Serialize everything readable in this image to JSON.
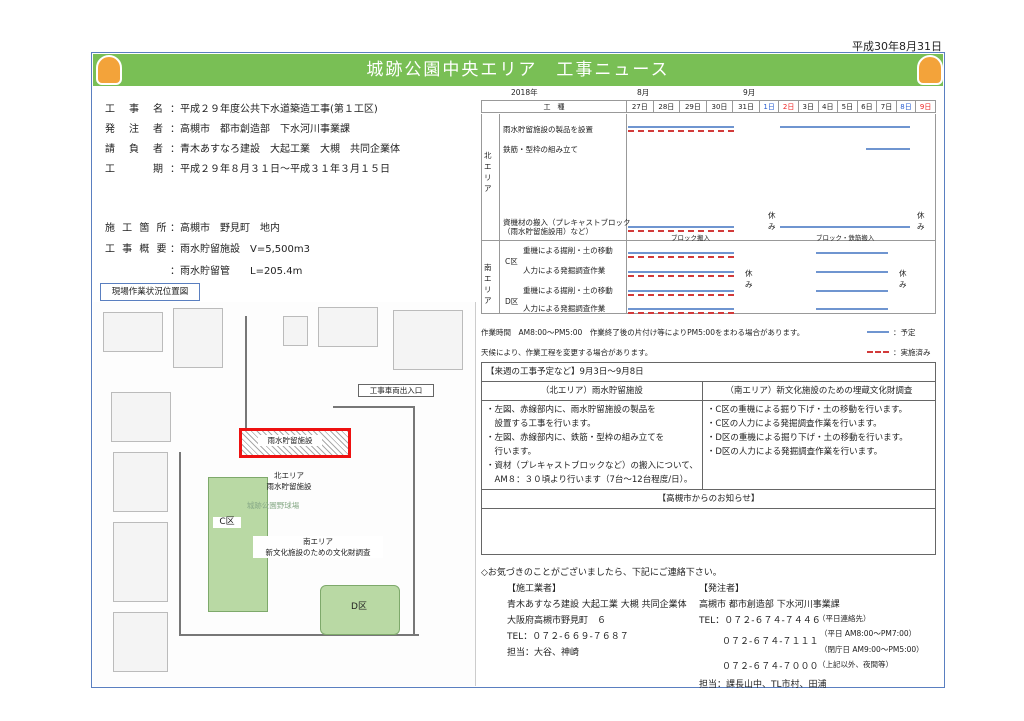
{
  "date": "平成30年8月31日",
  "title": "城跡公園中央エリア　工事ニュース",
  "info": [
    {
      "label": "工　事　名",
      "value": "：平成２９年度公共下水道築造工事(第１工区)"
    },
    {
      "label": "発　注　者",
      "value": "：高槻市　都市創造部　下水河川事業課"
    },
    {
      "label": "請　負　者",
      "value": "：青木あすなろ建設　大起工業　大槻　共同企業体"
    },
    {
      "label": "工　　　期",
      "value": "：平成２９年８月３１日～平成３１年３月１５日"
    },
    {
      "label": "施 工 箇 所",
      "value": "：高槻市　野見町　地内"
    },
    {
      "label": "工 事 概 要",
      "value": "：雨水貯留施設　V=5,500m3"
    },
    {
      "label": "",
      "value": "：雨水貯留管　　L=205.4m"
    }
  ],
  "map": {
    "caption": "現場作業状況位置図",
    "labels": {
      "storage": "雨水貯留施設",
      "entrance": "工事車両出入口",
      "north": "北エリア\n雨水貯留施設",
      "south": "南エリア\n新文化施設のための文化財調査",
      "c": "C区",
      "d": "D区",
      "park": "城跡公園野球場"
    }
  },
  "schedule": {
    "year": "2018年",
    "month1": "8月",
    "month2": "9月",
    "header": "工　種",
    "days": [
      "27日",
      "28日",
      "29日",
      "30日",
      "31日",
      "1日",
      "2日",
      "3日",
      "4日",
      "5日",
      "6日",
      "7日",
      "8日",
      "9日"
    ],
    "north": "北エリア",
    "south": "南エリア",
    "tasks": [
      "雨水貯留施設の製品を設置",
      "鉄筋・型枠の組み立て",
      "資機材の搬入（プレキャストブロック\n（雨水貯留施設用）など）",
      "重機による掘削・土の移動",
      "人力による発掘調査作業",
      "重機による掘削・土の移動",
      "人力による発掘調査作業"
    ],
    "zoneC": "C区",
    "zoneD": "D区",
    "rest": "休み",
    "blockIn": "ブロック搬入",
    "blockRebar": "ブロック・鉄筋搬入",
    "hours": "作業時間　AM8:00～PM5:00　作業終了後の片付け等によりPM5:00をまわる場合があります。",
    "weather": "天候により、作業工程を変更する場合があります。",
    "legendPlan": "：予定",
    "legendDone": "：実施済み"
  },
  "upcoming": {
    "title": "【来週の工事予定など】9月3日～9月8日",
    "northHead": "（北エリア）雨水貯留施設",
    "southHead": "（南エリア）新文化施設のための埋蔵文化財調査",
    "north": [
      "・左図、赤線部内に、雨水貯留施設の製品を",
      "　設置する工事を行います。",
      "・左図、赤線部内に、鉄筋・型枠の組み立てを",
      "　行います。",
      "・資材（プレキャストブロックなど）の搬入について、",
      "　AM８：３０頃より行います（7台～12台程度/日）。"
    ],
    "south": [
      "・C区の重機による掘り下げ・土の移動を行います。",
      "・C区の人力による発掘調査作業を行います。",
      "・D区の重機による掘り下げ・土の移動を行います。",
      "・D区の人力による発掘調査作業を行います。"
    ],
    "notice": "【高槻市からのお知らせ】"
  },
  "contact": {
    "intro": "◇お気づきのことがございましたら、下記にご連絡下さい。",
    "builderHead": "【施工業者】",
    "builder": [
      "青木あすなろ建設 大起工業 大槻 共同企業体",
      "大阪府高槻市野見町　６",
      "TEL：０７２-６６９-７６８７",
      "担当：大谷、神崎"
    ],
    "ordererHead": "【発注者】",
    "orderer": "高槻市 都市創造部 下水河川事業課",
    "tel1": "TEL：０７２-６７４-７４４６",
    "tel1note": "（平日連絡先）",
    "tel2": "０７２-６７４-７１１１",
    "tel2note1": "（平日 AM8:00～PM7:00）",
    "tel2note2": "（閉庁日 AM9:00～PM5:00）",
    "tel3": "０７２-６７４-７０００",
    "tel3note": "（上記以外、夜間等）",
    "contact": "担当：課長山中、TL市村、田浦"
  }
}
